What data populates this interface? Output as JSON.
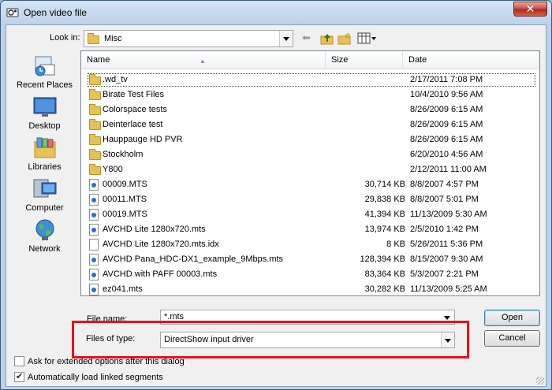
{
  "window": {
    "title": "Open video file",
    "close_label": "✕"
  },
  "lookin": {
    "label": "Look in:",
    "value": "Misc"
  },
  "places": [
    {
      "label": "Recent Places",
      "icon": "recent-places-icon"
    },
    {
      "label": "Desktop",
      "icon": "desktop-icon"
    },
    {
      "label": "Libraries",
      "icon": "libraries-icon"
    },
    {
      "label": "Computer",
      "icon": "computer-icon"
    },
    {
      "label": "Network",
      "icon": "network-icon"
    }
  ],
  "columns": {
    "name": "Name",
    "size": "Size",
    "date": "Date"
  },
  "files": [
    {
      "name": ".wd_tv",
      "size": "",
      "date": "2/17/2011 7:08 PM",
      "type": "folder"
    },
    {
      "name": "Birate Test Files",
      "size": "",
      "date": "10/4/2010 9:56 AM",
      "type": "folder"
    },
    {
      "name": "Colorspace tests",
      "size": "",
      "date": "8/26/2009 6:15 AM",
      "type": "folder"
    },
    {
      "name": "Deinterlace test",
      "size": "",
      "date": "8/26/2009 6:15 AM",
      "type": "folder"
    },
    {
      "name": "Hauppauge HD PVR",
      "size": "",
      "date": "8/26/2009 6:15 AM",
      "type": "folder"
    },
    {
      "name": "Stockholm",
      "size": "",
      "date": "6/20/2010 4:56 AM",
      "type": "folder"
    },
    {
      "name": "Y800",
      "size": "",
      "date": "2/12/2011 11:00 AM",
      "type": "folder"
    },
    {
      "name": "00009.MTS",
      "size": "30,714 KB",
      "date": "8/8/2007 4:57 PM",
      "type": "media"
    },
    {
      "name": "00011.MTS",
      "size": "29,838 KB",
      "date": "8/8/2007 5:01 PM",
      "type": "media"
    },
    {
      "name": "00019.MTS",
      "size": "41,394 KB",
      "date": "11/13/2009 5:30 AM",
      "type": "media"
    },
    {
      "name": "AVCHD Lite 1280x720.mts",
      "size": "13,974 KB",
      "date": "2/5/2010 1:42 PM",
      "type": "media"
    },
    {
      "name": "AVCHD Lite 1280x720.mts.idx",
      "size": "8 KB",
      "date": "5/26/2011 5:36 PM",
      "type": "doc"
    },
    {
      "name": "AVCHD Pana_HDC-DX1_example_9Mbps.mts",
      "size": "128,394 KB",
      "date": "8/15/2007 9:30 AM",
      "type": "media"
    },
    {
      "name": "AVCHD with PAFF 00003.mts",
      "size": "83,364 KB",
      "date": "5/3/2007 2:21 PM",
      "type": "media"
    },
    {
      "name": "ez041.mts",
      "size": "30,282 KB",
      "date": "11/13/2009 5:25 AM",
      "type": "media"
    }
  ],
  "filename": {
    "label": "File name:",
    "value": "*.mts"
  },
  "filetype": {
    "label": "Files of type:",
    "value": "DirectShow input driver"
  },
  "buttons": {
    "open": "Open",
    "cancel": "Cancel"
  },
  "options": {
    "extended_label": "Ask for extended options after this dialog",
    "extended_checked": false,
    "linked_label": "Automatically load linked segments",
    "linked_checked": true
  },
  "highlight_color": "#e8121b"
}
